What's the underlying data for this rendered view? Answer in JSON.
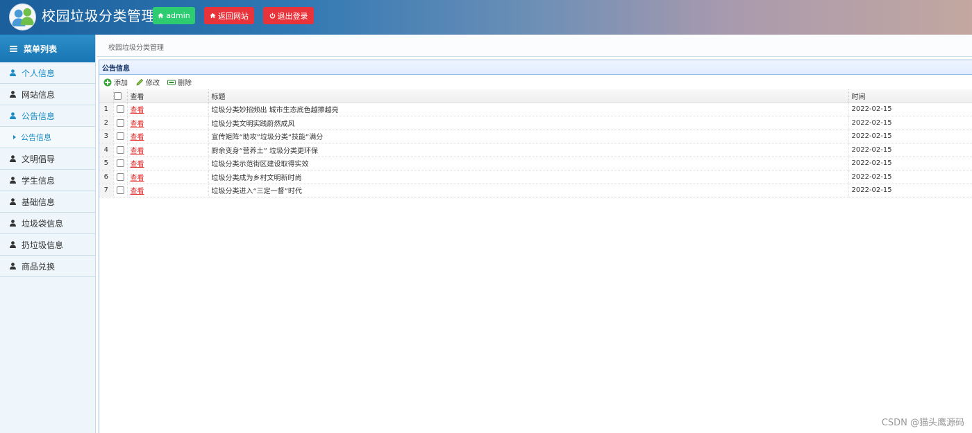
{
  "header": {
    "title": "校园垃圾分类管理",
    "admin_label": "admin",
    "back_label": "返回网站",
    "logout_label": "退出登录"
  },
  "sidebar": {
    "heading": "菜单列表",
    "items": [
      {
        "label": "个人信息",
        "active": true
      },
      {
        "label": "网站信息",
        "active": false
      },
      {
        "label": "公告信息",
        "active": true
      },
      {
        "label": "文明倡导",
        "active": false
      },
      {
        "label": "学生信息",
        "active": false
      },
      {
        "label": "基础信息",
        "active": false
      },
      {
        "label": "垃圾袋信息",
        "active": false
      },
      {
        "label": "扔垃圾信息",
        "active": false
      },
      {
        "label": "商品兑换",
        "active": false
      }
    ],
    "sub_item": "公告信息"
  },
  "breadcrumb": "校园垃圾分类管理",
  "panel": {
    "title": "公告信息",
    "toolbar": {
      "add": "添加",
      "edit": "修改",
      "delete": "删除"
    },
    "columns": {
      "view": "查看",
      "title": "标题",
      "time": "时间"
    },
    "rows": [
      {
        "num": "1",
        "view": "查看",
        "title": "垃圾分类妙招频出 城市生态底色越擦越亮",
        "time": "2022-02-15"
      },
      {
        "num": "2",
        "view": "查看",
        "title": "垃圾分类文明实践蔚然成风",
        "time": "2022-02-15"
      },
      {
        "num": "3",
        "view": "查看",
        "title": "宣传矩阵“助攻”垃圾分类“技能”满分",
        "time": "2022-02-15"
      },
      {
        "num": "4",
        "view": "查看",
        "title": "厨余变身“营养土” 垃圾分类更环保",
        "time": "2022-02-15"
      },
      {
        "num": "5",
        "view": "查看",
        "title": "垃圾分类示范街区建设取得实效",
        "time": "2022-02-15"
      },
      {
        "num": "6",
        "view": "查看",
        "title": "垃圾分类成为乡村文明新时尚",
        "time": "2022-02-15"
      },
      {
        "num": "7",
        "view": "查看",
        "title": "垃圾分类进入“三定一督”时代",
        "time": "2022-02-15"
      }
    ]
  },
  "watermark": "CSDN @猫头鹰源码",
  "colors": {
    "accent": "#1a8ac4",
    "green": "#2ecc71",
    "red": "#e8333a",
    "link": "#e02424"
  }
}
